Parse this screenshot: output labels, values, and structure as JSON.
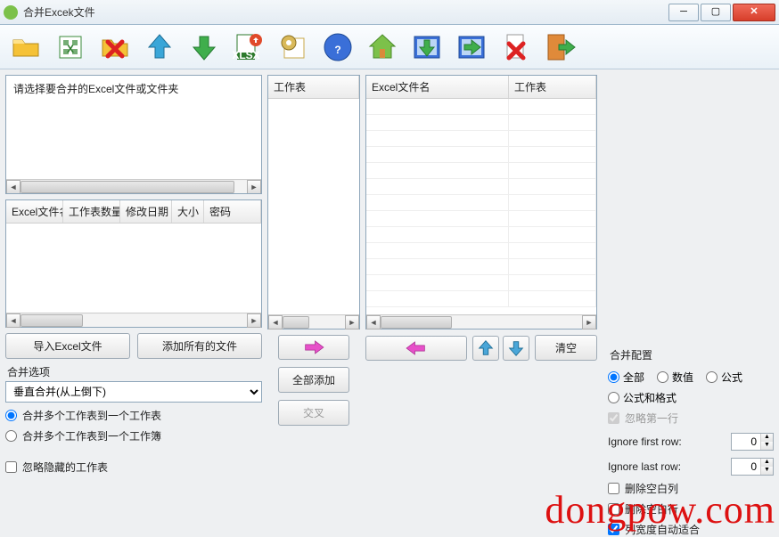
{
  "window": {
    "title": "合并Excek文件"
  },
  "panels": {
    "select_files_label": "请选择要合并的Excel文件或文件夹",
    "file_table_cols": [
      "Excel文件名",
      "工作表数量",
      "修改日期",
      "大小",
      "密码"
    ],
    "worksheet_label": "工作表",
    "excel_name_label": "Excel文件名",
    "worksheet_label2": "工作表"
  },
  "buttons": {
    "import_excel": "导入Excel文件",
    "add_all_files": "添加所有的文件",
    "add_all": "全部添加",
    "cross": "交叉",
    "clear": "清空"
  },
  "merge_options": {
    "group_label": "合并选项",
    "combo_value": "垂直合并(从上倒下)",
    "radio1": "合并多个工作表到一个工作表",
    "radio2": "合并多个工作表到一个工作簿",
    "ignore_hidden": "忽略隐藏的工作表"
  },
  "merge_config": {
    "group_label": "合并配置",
    "r_all": "全部",
    "r_numeric": "数值",
    "r_formula": "公式",
    "r_formula_format": "公式和格式",
    "cb_ignore_first": "忽略第一行",
    "ignore_first_label": "Ignore first row:",
    "ignore_first_val": "0",
    "ignore_last_label": "Ignore last row:",
    "ignore_last_val": "0",
    "cb_del_empty_col": "删除空白列",
    "cb_del_empty_row": "删除空白行",
    "cb_auto_width": "列宽度自动适合"
  },
  "watermark": "dongpow.com"
}
